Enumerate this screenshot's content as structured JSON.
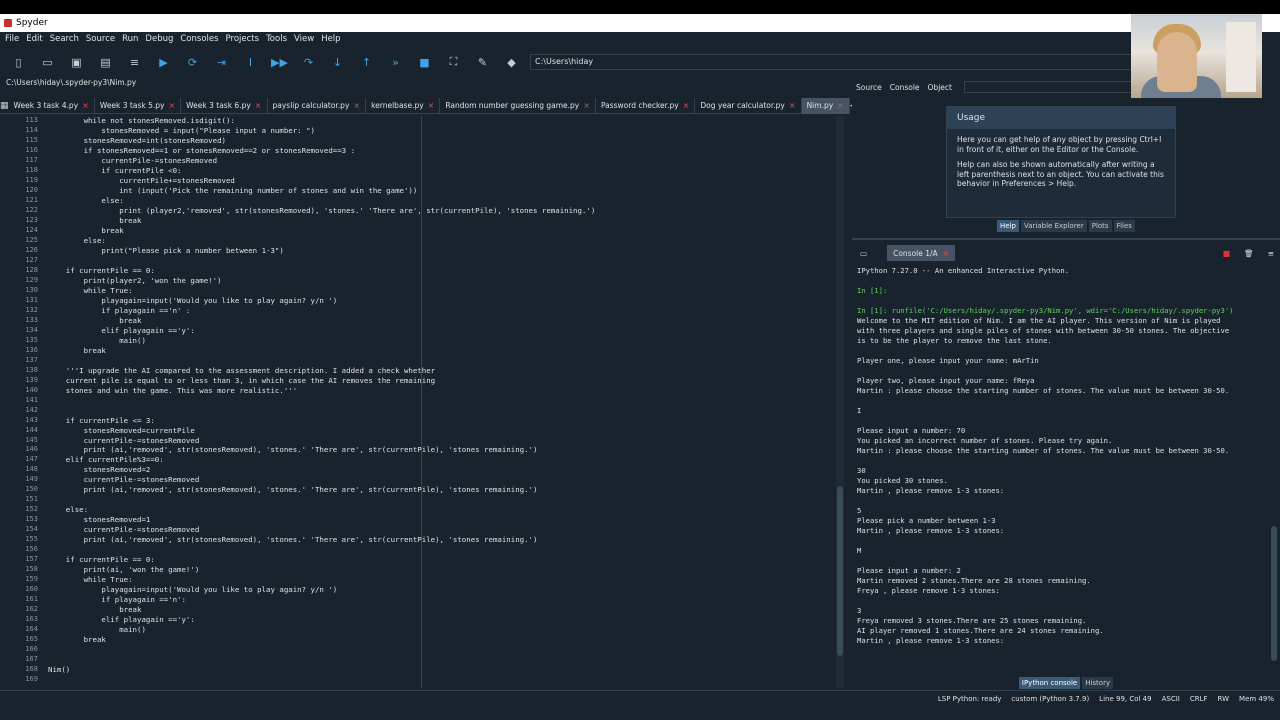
{
  "window_title": "Spyder",
  "menu": [
    "File",
    "Edit",
    "Search",
    "Source",
    "Run",
    "Debug",
    "Consoles",
    "Projects",
    "Tools",
    "View",
    "Help"
  ],
  "toolbar": {
    "path": "C:\\Users\\hiday"
  },
  "editor_path": "C:\\Users\\hiday\\.spyder-py3\\Nim.py",
  "tabs": [
    "Week 3 task 4.py",
    "Week 3 task 5.py",
    "Week 3 task 6.py",
    "payslip calculator.py",
    "kernelbase.py",
    "Random number guessing game.py",
    "Password checker.py",
    "Dog year calculator.py",
    "Nim.py"
  ],
  "active_tab": "Nim.py",
  "line_numbers": [
    "113",
    "114",
    "115",
    "116",
    "117",
    "118",
    "119",
    "120",
    "121",
    "122",
    "123",
    "124",
    "125",
    "126",
    "127",
    "128",
    "129",
    "130",
    "131",
    "132",
    "133",
    "134",
    "135",
    "136",
    "137",
    "138",
    "139",
    "140",
    "141",
    "142",
    "143",
    "144",
    "145",
    "146",
    "147",
    "148",
    "149",
    "150",
    "151",
    "152",
    "153",
    "154",
    "155",
    "156",
    "157",
    "158",
    "159",
    "160",
    "161",
    "162",
    "163",
    "164",
    "165",
    "166",
    "167",
    "168",
    "169"
  ],
  "code_lines": [
    "        while not stonesRemoved.isdigit():",
    "            stonesRemoved = input(\"Please input a number: \")",
    "        stonesRemoved=int(stonesRemoved)",
    "        if stonesRemoved==1 or stonesRemoved==2 or stonesRemoved==3 :",
    "            currentPile-=stonesRemoved",
    "            if currentPile <0:",
    "                currentPile+=stonesRemoved",
    "                int (input('Pick the remaining number of stones and win the game'))",
    "            else:",
    "                print (player2,'removed', str(stonesRemoved), 'stones.' 'There are', str(currentPile), 'stones remaining.')",
    "                break",
    "            break",
    "        else:",
    "            print(\"Please pick a number between 1-3\")",
    "",
    "    if currentPile == 0:",
    "        print(player2, 'won the game!')",
    "        while True:",
    "            playagain=input('Would you like to play again? y/n ')",
    "            if playagain =='n' :",
    "                break",
    "            elif playagain =='y':",
    "                main()",
    "        break",
    "",
    "    '''I upgrade the AI compared to the assessment description. I added a check whether",
    "    current pile is equal to or less than 3, in which case the AI removes the remaining",
    "    stones and win the game. This was more realistic.'''",
    "",
    "",
    "    if currentPile <= 3:",
    "        stonesRemoved=currentPile",
    "        currentPile-=stonesRemoved",
    "        print (ai,'removed', str(stonesRemoved), 'stones.' 'There are', str(currentPile), 'stones remaining.')",
    "    elif currentPile%3==0:",
    "        stonesRemoved=2",
    "        currentPile-=stonesRemoved",
    "        print (ai,'removed', str(stonesRemoved), 'stones.' 'There are', str(currentPile), 'stones remaining.')",
    "",
    "    else:",
    "        stonesRemoved=1",
    "        currentPile-=stonesRemoved",
    "        print (ai,'removed', str(stonesRemoved), 'stones.' 'There are', str(currentPile), 'stones remaining.')",
    "",
    "    if currentPile == 0:",
    "        print(ai, 'won the game!')",
    "        while True:",
    "            playagain=input('Would you like to play again? y/n ')",
    "            if playagain =='n':",
    "                break",
    "            elif playagain =='y':",
    "                main()",
    "        break",
    "",
    "",
    "Nim()",
    ""
  ],
  "right_top": {
    "source_label": "Source",
    "console_select": "Console",
    "object_label": "Object"
  },
  "help": {
    "title": "Usage",
    "p1": "Here you can get help of any object by pressing Ctrl+I in front of it, either on the Editor or the Console.",
    "p2": "Help can also be shown automatically after writing a left parenthesis next to an object. You can activate this behavior in Preferences > Help."
  },
  "help_tabs": [
    "Help",
    "Variable Explorer",
    "Plots",
    "Files"
  ],
  "console_tab": "Console 1/A",
  "console_lines": [
    "IPython 7.27.0 -- An enhanced Interactive Python.",
    "",
    "In [1]:",
    "",
    "In [1]: runfile('C:/Users/hiday/.spyder-py3/Nim.py', wdir='C:/Users/hiday/.spyder-py3')",
    "Welcome to the MIT edition of Nim. I am the AI player. This version of Nim is played",
    "with three players and single piles of stones with between 30-50 stones. The objective",
    "is to be the player to remove the last stone.",
    "",
    "Player one, please input your name: mArTin",
    "",
    "Player two, please input your name: fReya",
    "Martin : please choose the starting number of stones. The value must be between 30-50.",
    "",
    "I",
    "",
    "Please input a number: 70",
    "You picked an incorrect number of stones. Please try again.",
    "Martin : please choose the starting number of stones. The value must be between 30-50.",
    "",
    "30",
    "You picked 30 stones.",
    "Martin , please remove 1-3 stones:",
    "",
    "5",
    "Please pick a number between 1-3",
    "Martin , please remove 1-3 stones:",
    "",
    "M",
    "",
    "Please input a number: 2",
    "Martin removed 2 stones.There are 28 stones remaining.",
    "Freya , please remove 1-3 stones:",
    "",
    "3",
    "Freya removed 3 stones.There are 25 stones remaining.",
    "AI player removed 1 stones.There are 24 stones remaining.",
    "Martin , please remove 1-3 stones:"
  ],
  "console_bottom_tabs": [
    "IPython console",
    "History"
  ],
  "status": {
    "lsp": "LSP Python: ready",
    "env": "custom (Python 3.7.9)",
    "position": "Line 99, Col 49",
    "encoding": "ASCII",
    "eol": "CRLF",
    "rw": "RW",
    "mem": "Mem 49%"
  }
}
